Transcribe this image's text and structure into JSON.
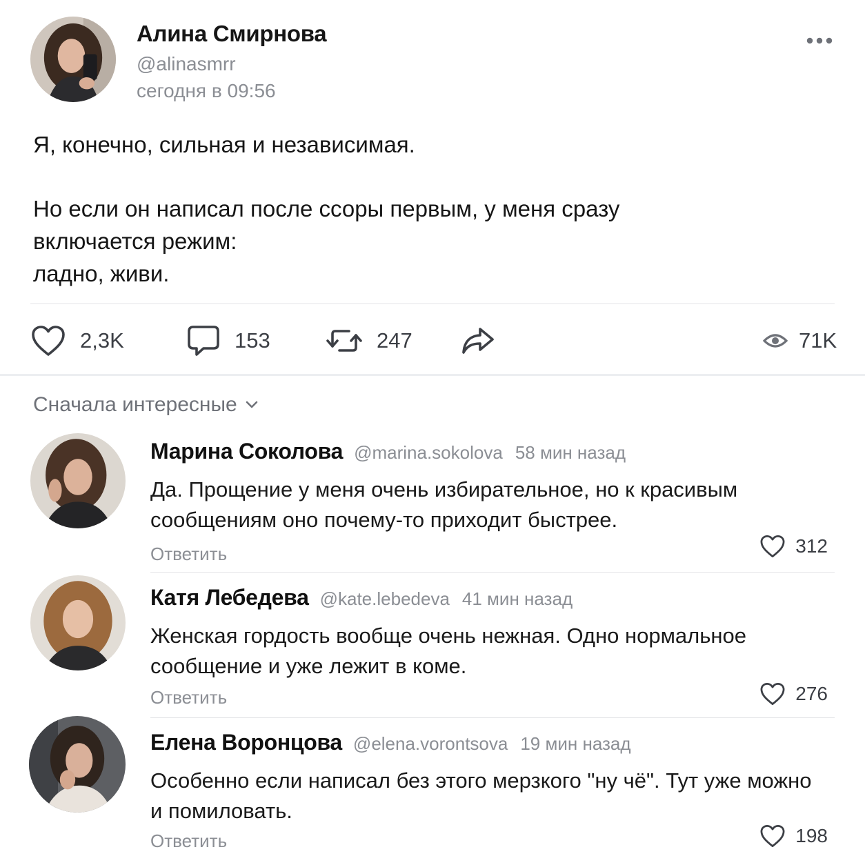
{
  "post": {
    "author_name": "Алина Смирнова",
    "author_handle": "@alinasmrr",
    "time": "сегодня в 09:56",
    "paragraph1": "Я, конечно, сильная и независимая.",
    "paragraph2_line1": "Но если он написал после ссоры первым, у меня сразу",
    "paragraph2_line2": "включается режим:",
    "paragraph2_line3": "ладно, живи.",
    "likes": "2,3K",
    "comments": "153",
    "reposts": "247",
    "views": "71K"
  },
  "sort": {
    "label": "Сначала интересные"
  },
  "comments": [
    {
      "name": "Марина Соколова",
      "handle": "@marina.sokolova",
      "time": "58 мин назад",
      "text": "Да. Прощение у меня очень избирательное, но к красивым сообщениям оно почему-то приходит быстрее.",
      "reply": "Ответить",
      "likes": "312"
    },
    {
      "name": "Катя Лебедева",
      "handle": "@kate.lebedeva",
      "time": "41 мин назад",
      "text": "Женская гордость вообще очень нежная. Одно нормальное сообщение и уже лежит в коме.",
      "reply": "Ответить",
      "likes": "276"
    },
    {
      "name": "Елена Воронцова",
      "handle": "@elena.vorontsova",
      "time": "19 мин назад",
      "text": "Особенно если написал без этого мерзкого \"ну чё\". Тут уже можно и помиловать.",
      "reply": "Ответить",
      "likes": "198"
    }
  ],
  "icons": {
    "like": "heart-icon",
    "comment": "comment-icon",
    "repost": "repost-icon",
    "share": "share-icon",
    "views": "eye-icon",
    "more": "more-dots-icon",
    "sort": "chevron-down-icon"
  },
  "colors": {
    "text": "#161616",
    "secondary": "#8b8e94",
    "icon": "#3c3f45",
    "divider": "#e3e4e7"
  }
}
